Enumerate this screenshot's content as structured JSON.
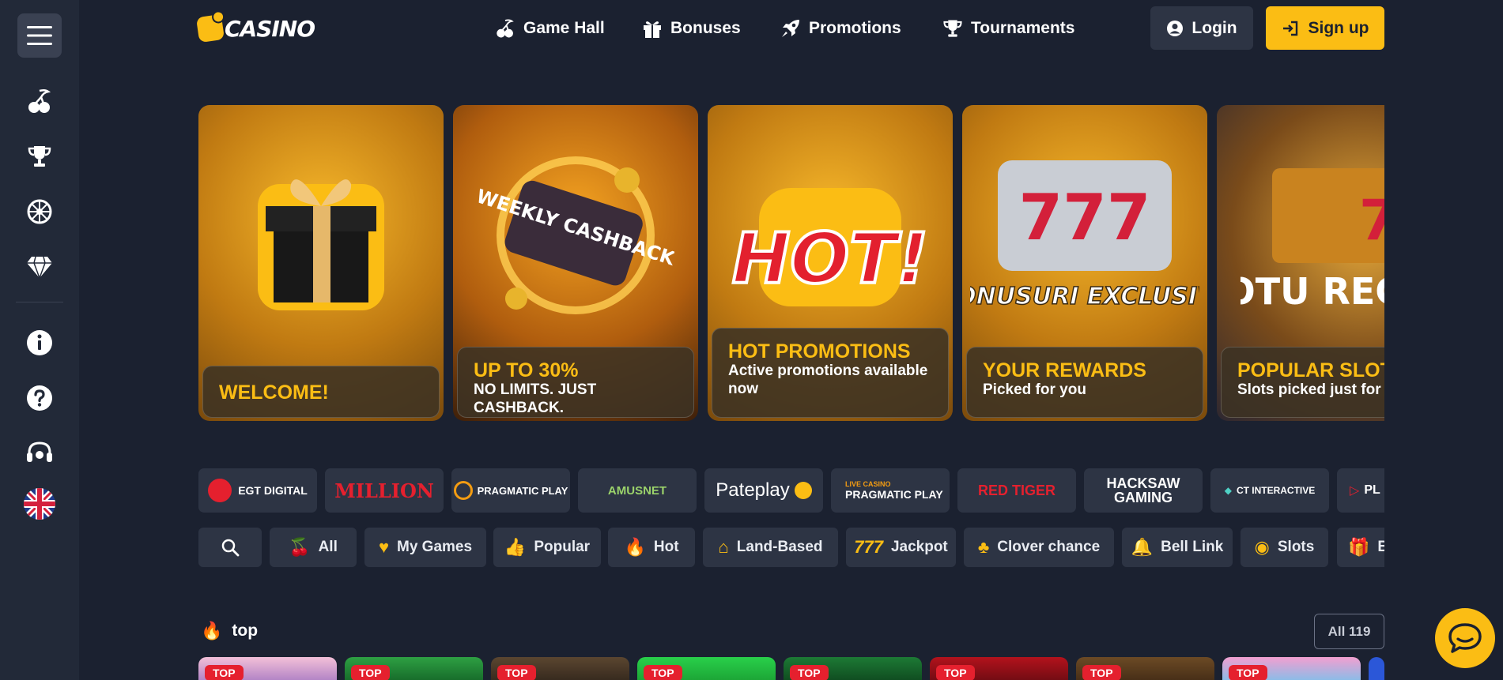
{
  "brand": {
    "logo_text": "CASINO",
    "accent": "#fbbd14",
    "background": "#1b2130"
  },
  "nav": [
    {
      "label": "Game Hall",
      "icon": "cherry-icon"
    },
    {
      "label": "Bonuses",
      "icon": "gift-icon"
    },
    {
      "label": "Promotions",
      "icon": "rocket-icon"
    },
    {
      "label": "Tournaments",
      "icon": "trophy-icon"
    }
  ],
  "auth": {
    "login_label": "Login",
    "signup_label": "Sign up"
  },
  "sidebar": {
    "icons": [
      "menu-icon",
      "cherry-icon",
      "trophy-icon",
      "wheel-icon",
      "diamond-icon",
      "info-icon",
      "help-icon",
      "support-icon",
      "flag-uk-icon"
    ]
  },
  "promos": [
    {
      "title": "WELCOME!",
      "subtitle": "",
      "art": "gift-box"
    },
    {
      "title": "UP TO 30%",
      "subtitle": "NO LIMITS. JUST CASHBACK.",
      "art": "weekly-cashback-wallet",
      "art_text": "WEEKLY CASHBACK"
    },
    {
      "title": "HOT PROMOTIONS",
      "subtitle": "Active promotions available now",
      "art": "hot",
      "art_text": "HOT!"
    },
    {
      "title": "YOUR REWARDS",
      "subtitle": "Picked for you",
      "art": "slot-777",
      "art_text": "BONUSURI EXCLUSIVE"
    },
    {
      "title": "POPULAR SLOT",
      "subtitle": "Slots picked just for y",
      "art": "slot-machine",
      "art_text": "SLOTU RECOMAND"
    }
  ],
  "providers": [
    "EGT DIGITAL",
    "MILLION",
    "PRAGMATIC PLAY",
    "AMUSNET",
    "Pateplay",
    "PRAGMATIC PLAY",
    "RED TIGER",
    "HACKSAW GAMING",
    "CT INTERACTIVE",
    "PL"
  ],
  "provider_extras": {
    "live_casino": "LIVE CASINO"
  },
  "categories": [
    {
      "label": "All",
      "icon": "cherry-icon"
    },
    {
      "label": "My Games",
      "icon": "heart-icon"
    },
    {
      "label": "Popular",
      "icon": "thumbs-up-icon"
    },
    {
      "label": "Hot",
      "icon": "fire-icon"
    },
    {
      "label": "Land-Based",
      "icon": "bell-house-icon"
    },
    {
      "label": "Jackpot",
      "icon": "777-icon"
    },
    {
      "label": "Clover chance",
      "icon": "clover-icon"
    },
    {
      "label": "Bell Link",
      "icon": "bell-icon"
    },
    {
      "label": "Slots",
      "icon": "coins-icon"
    },
    {
      "label": "B",
      "icon": "gift-icon"
    }
  ],
  "section": {
    "title": "top",
    "all_label": "All 119"
  },
  "games": [
    {
      "tag": "TOP"
    },
    {
      "tag": "TOP"
    },
    {
      "tag": "TOP"
    },
    {
      "tag": "TOP"
    },
    {
      "tag": "TOP"
    },
    {
      "tag": "TOP"
    },
    {
      "tag": "TOP"
    },
    {
      "tag": "TOP"
    }
  ]
}
